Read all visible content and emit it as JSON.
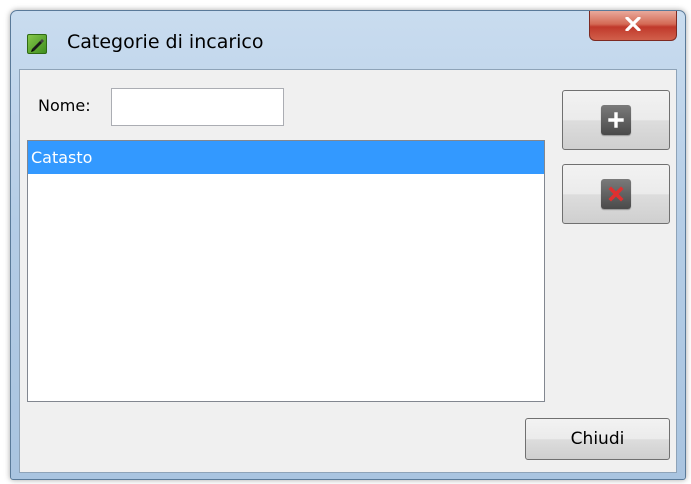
{
  "window": {
    "title": "Categorie di incarico",
    "close_icon": "close-icon"
  },
  "form": {
    "name_label": "Nome:",
    "name_value": "",
    "name_placeholder": ""
  },
  "list": {
    "items": [
      {
        "label": "Catasto",
        "selected": true
      }
    ]
  },
  "buttons": {
    "add_icon": "plus-icon",
    "remove_icon": "red-x-icon",
    "close_label": "Chiudi"
  },
  "colors": {
    "selection": "#3399ff",
    "title_bar": "#b5cde6",
    "close_button": "#c0392b",
    "remove_icon_color": "#e03030"
  }
}
